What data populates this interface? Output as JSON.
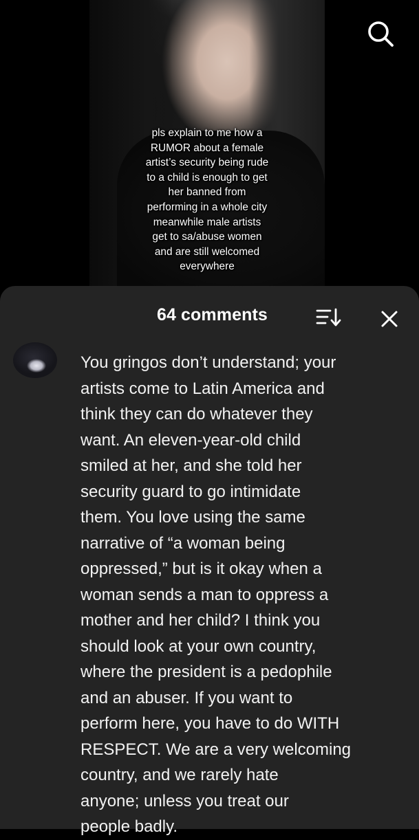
{
  "video": {
    "overlay_text": "pls explain to me how a\nRUMOR about a female\nartist’s security being rude\nto a child is enough to get\nher banned from\nperforming in a whole city\nmeanwhile male artists\nget to sa/abuse women\nand are still welcomed\neverywhere"
  },
  "top_bar": {
    "search_icon": "search-icon"
  },
  "comments_sheet": {
    "count_label": "64 comments",
    "sort_icon": "sort-icon",
    "close_icon": "close-icon",
    "comment": {
      "avatar": "avatar",
      "text": "You gringos don’t understand; your\nartists come to Latin America and\nthink they can do whatever they\nwant. An eleven-year-old child\nsmiled at her, and she told her\nsecurity guard to go intimidate\nthem. You love using the same\nnarrative of “a woman being\noppressed,” but is it okay when a\nwoman sends a man to oppress a\nmother and her child? I think you\nshould look at your own country,\nwhere the president is a pedophile\nand an abuser. If you want to\nperform here, you have to do WITH\nRESPECT. We are a very welcoming\ncountry, and we rarely hate\nanyone; unless you treat our\npeople badly."
    }
  },
  "colors": {
    "background": "#000000",
    "sheet": "#242424",
    "text": "#ffffff"
  }
}
